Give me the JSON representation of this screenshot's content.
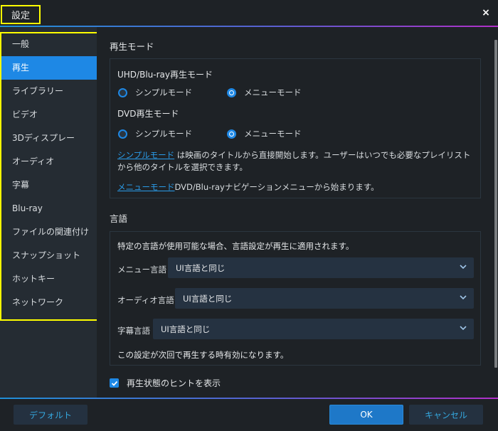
{
  "window": {
    "title": "設定",
    "close_icon": "×"
  },
  "sidebar": {
    "items": [
      {
        "label": "一般",
        "active": false
      },
      {
        "label": "再生",
        "active": true
      },
      {
        "label": "ライブラリー",
        "active": false
      },
      {
        "label": "ビデオ",
        "active": false
      },
      {
        "label": "3Dディスプレー",
        "active": false
      },
      {
        "label": "オーディオ",
        "active": false
      },
      {
        "label": "字幕",
        "active": false
      },
      {
        "label": "Blu-ray",
        "active": false
      },
      {
        "label": "ファイルの関連付け",
        "active": false
      },
      {
        "label": "スナップショット",
        "active": false
      },
      {
        "label": "ホットキー",
        "active": false
      },
      {
        "label": "ネットワーク",
        "active": false
      }
    ]
  },
  "playback_mode": {
    "section_title": "再生モード",
    "uhd_label": "UHD/Blu-ray再生モード",
    "uhd_options": [
      {
        "label": "シンプルモード",
        "checked": false
      },
      {
        "label": "メニューモード",
        "checked": true
      }
    ],
    "dvd_label": "DVD再生モード",
    "dvd_options": [
      {
        "label": "シンプルモード",
        "checked": false
      },
      {
        "label": "メニューモード",
        "checked": true
      }
    ],
    "simple_link": "シンプルモード",
    "simple_desc": " は映画のタイトルから直接開始します。ユーザーはいつでも必要なプレイリストから他のタイトルを選択できます。",
    "menu_link": "メニューモード",
    "menu_desc": "DVD/Blu-rayナビゲーションメニューから始まります。"
  },
  "language": {
    "section_title": "言語",
    "intro": "特定の言語が使用可能な場合、言語設定が再生に適用されます。",
    "menu_lang_label": "メニュー言語",
    "menu_lang_value": "UI言語と同じ",
    "audio_lang_label": "オーディオ言語",
    "audio_lang_value": "UI言語と同じ",
    "subtitle_lang_label": "字幕言語",
    "subtitle_lang_value": "UI言語と同じ",
    "note": "この設定が次回で再生する時有効になります。"
  },
  "show_hint": {
    "label": "再生状態のヒントを表示",
    "checked": true
  },
  "footer": {
    "default_label": "デフォルト",
    "ok_label": "OK",
    "cancel_label": "キャンセル"
  },
  "colors": {
    "accent": "#1e88e5",
    "link": "#2a9be8",
    "highlight_outline": "#ffff00"
  }
}
